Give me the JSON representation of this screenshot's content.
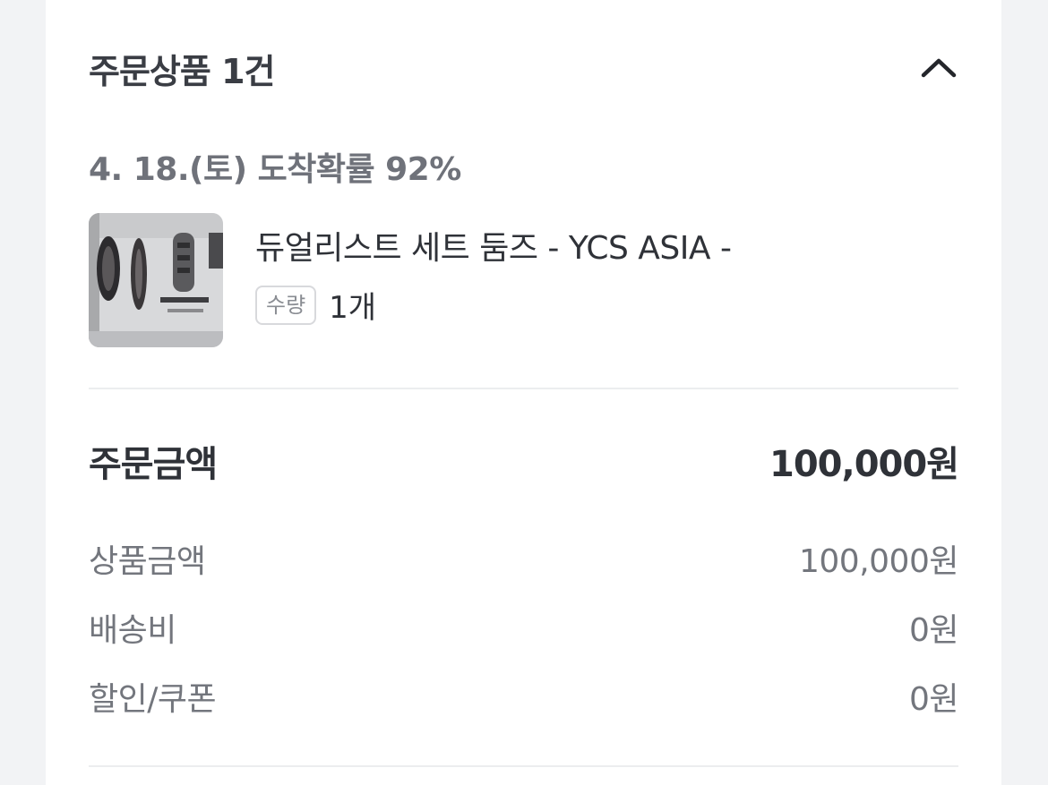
{
  "order_items": {
    "title": "주문상품 1건",
    "collapse_icon": "chevron-up-icon",
    "arrival_text": "4. 18.(토) 도착확률 92%",
    "product": {
      "name": "듀얼리스트 세트 둠즈 - YCS ASIA -",
      "quantity_label": "수량",
      "quantity_value": "1개"
    }
  },
  "summary": {
    "total_label": "주문금액",
    "total_value": "100,000원",
    "rows": [
      {
        "label": "상품금액",
        "value": "100,000원"
      },
      {
        "label": "배송비",
        "value": "0원"
      },
      {
        "label": "할인/쿠폰",
        "value": "0원"
      }
    ]
  },
  "colors": {
    "page_background": "#f2f3f5",
    "card_background": "#ffffff",
    "primary_text": "#2f3238",
    "secondary_text": "#73767d",
    "divider": "#ecedef"
  }
}
